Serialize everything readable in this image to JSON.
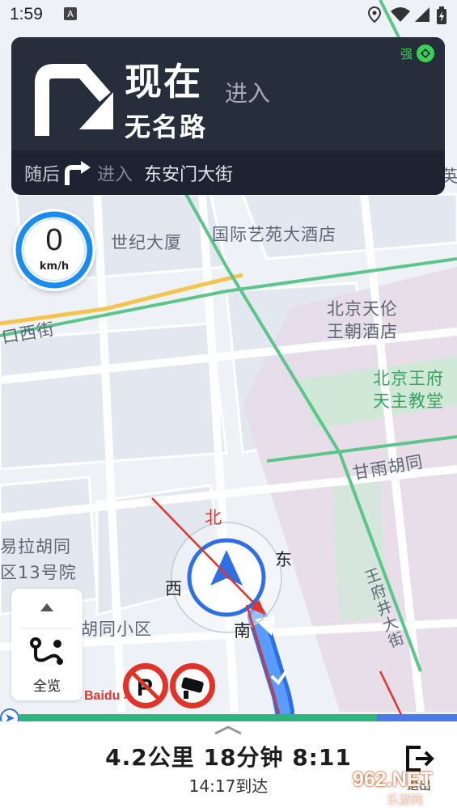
{
  "status_bar": {
    "time": "1:59",
    "icons": [
      "notification-icon",
      "location-icon",
      "wifi-icon",
      "signal-icon",
      "battery-icon"
    ]
  },
  "navigation": {
    "now_label": "现在",
    "enter_label": "进入",
    "road_name": "无名路",
    "gps_strength_label": "强",
    "next": {
      "then_label": "随后",
      "enter_label": "进入",
      "road_name": "东安门大街"
    },
    "turn_icon": "turn-right-icon",
    "next_turn_icon": "turn-right-icon"
  },
  "speed": {
    "value": "0",
    "unit": "km/h"
  },
  "map": {
    "labels": {
      "century_building": "世纪大厦",
      "yiyuan_hotel": "国际艺苑大酒店",
      "wangchao_hotel_line1": "北京天伦",
      "wangchao_hotel_line2": "王朝酒店",
      "church_line1": "北京王府",
      "church_line2": "天主教堂",
      "ganyu_hutong": "甘雨胡同",
      "xi_street": "口西街",
      "hutong_partial": "易拉胡同",
      "yard_13": "区13号院",
      "hutong_community": "胡同小区",
      "wangfujing": "王府井大街",
      "edge_partial": "英"
    },
    "compass": {
      "north": "北",
      "east": "东",
      "west": "西",
      "south": "南"
    },
    "colors": {
      "route": "#2f6fe6",
      "green_road": "#5cc58a",
      "yellow_road": "#f4c44e",
      "park": "#cfe9d6"
    }
  },
  "controls": {
    "overview_label": "全览",
    "collapse_icon": "chevron-up-icon",
    "overview_icon": "route-overview-icon"
  },
  "signs": {
    "logo_text": "Baidu 地图",
    "no_parking_icon": "no-parking-icon",
    "camera_icon": "speed-camera-icon"
  },
  "trip": {
    "summary": "4.2公里 18分钟 8:11",
    "arrival": "14:17到达",
    "exit_label": "退出"
  },
  "watermark": {
    "text": "962.NET",
    "sub": "乐游网"
  }
}
